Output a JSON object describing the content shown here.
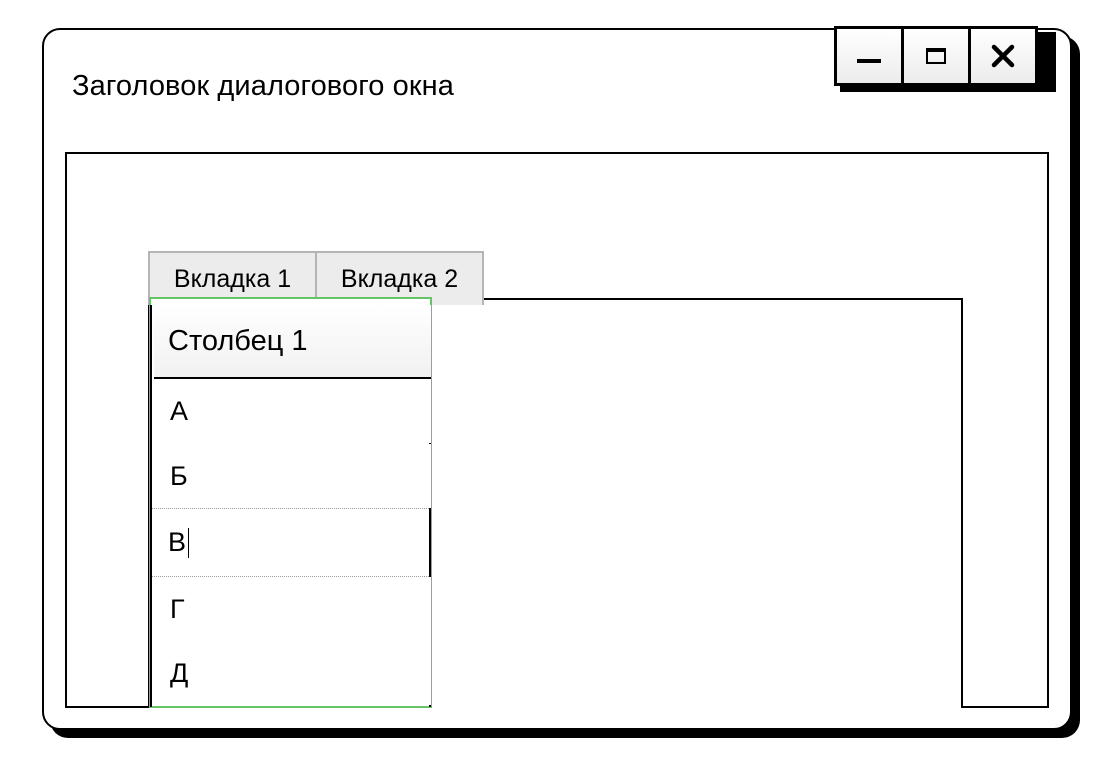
{
  "window": {
    "title": "Заголовок диалогового окна"
  },
  "controls": {
    "minimize_icon": "minimize-icon",
    "maximize_icon": "maximize-icon",
    "close_icon": "close-icon"
  },
  "tabs": [
    {
      "label": "Вкладка 1",
      "selected": true
    },
    {
      "label": "Вкладка 2",
      "selected": false
    }
  ],
  "grid": {
    "column_header": "Столбец 1",
    "rows": [
      {
        "value": "А"
      },
      {
        "value": "Б"
      },
      {
        "value": "В",
        "editing": true
      },
      {
        "value": "Г"
      },
      {
        "value": "Д"
      }
    ]
  },
  "colors": {
    "grid_focus_border": "#66c466",
    "tab_background": "#ececec"
  }
}
